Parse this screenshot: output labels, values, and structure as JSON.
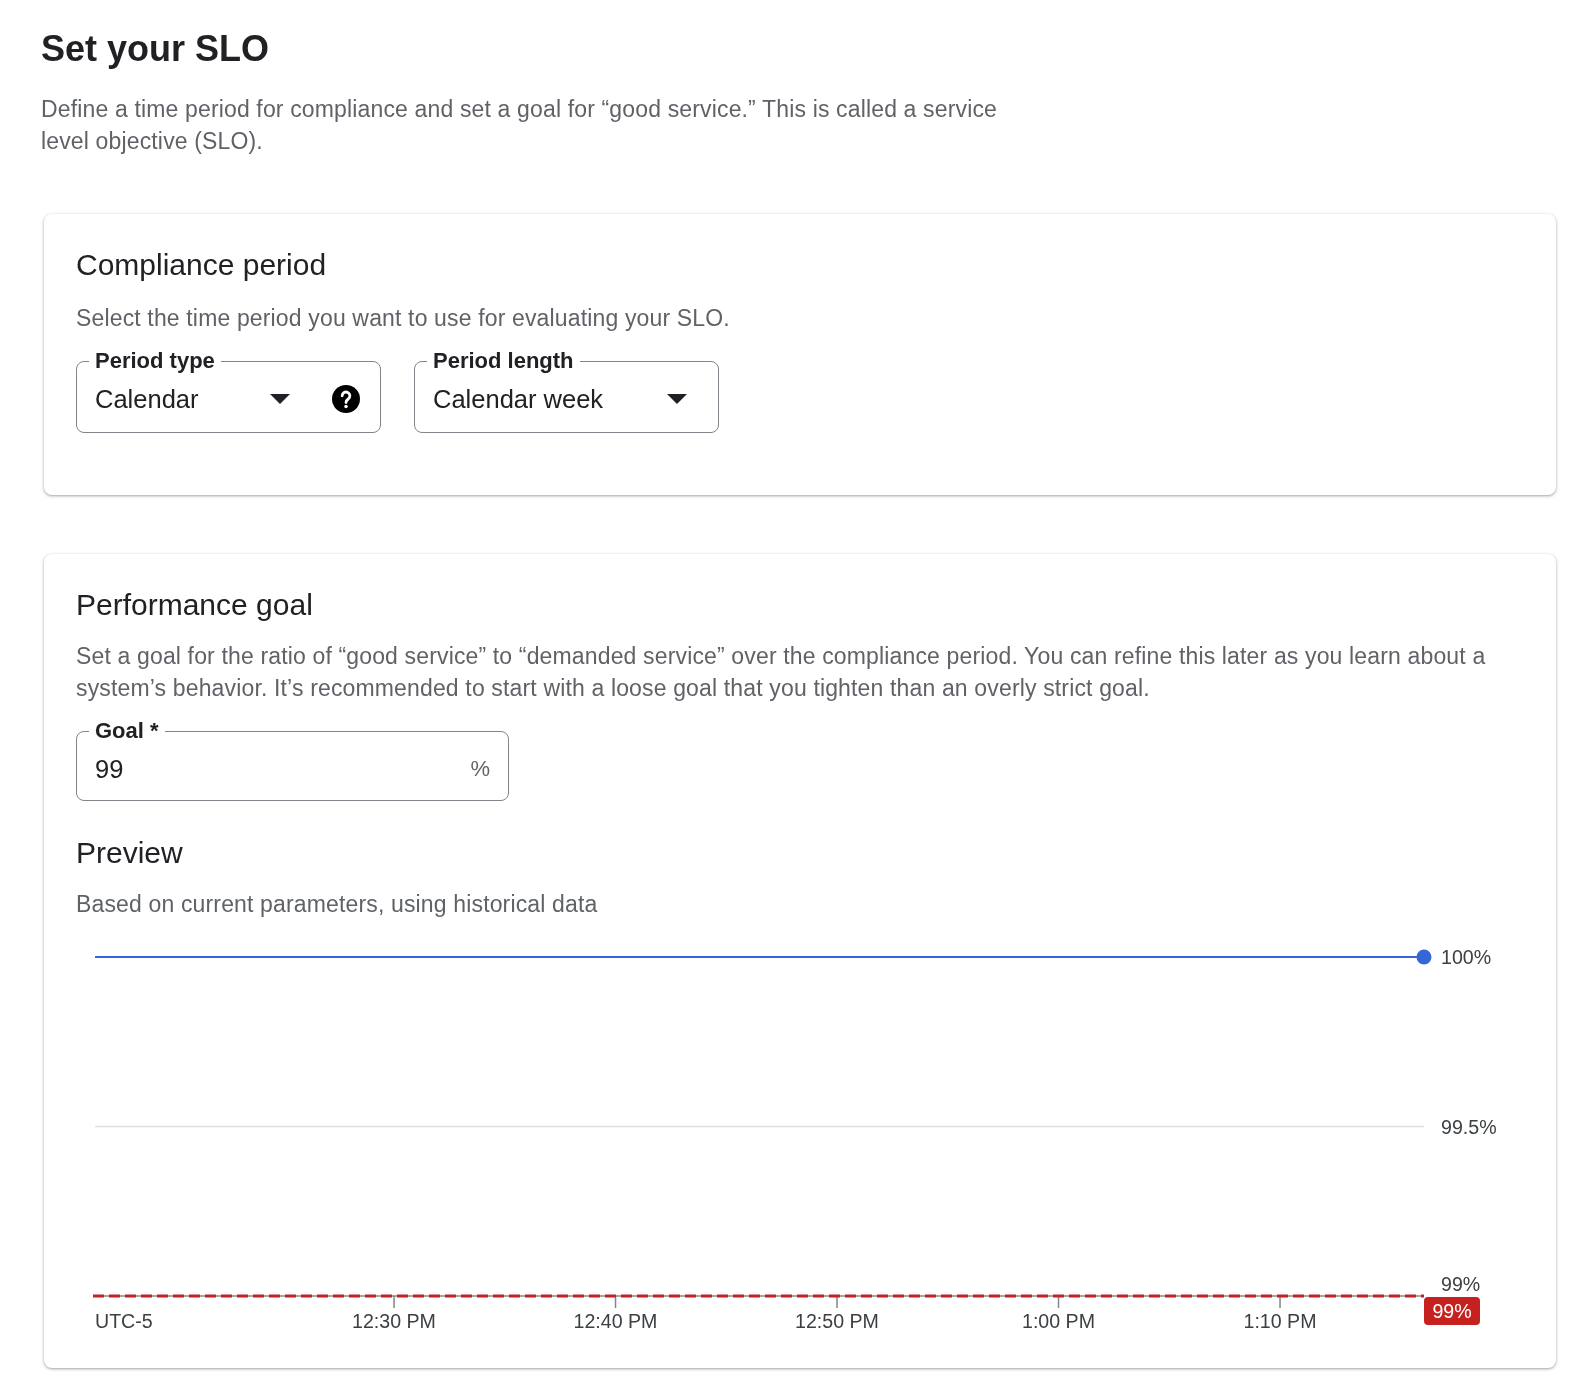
{
  "page": {
    "title": "Set your SLO",
    "description": "Define a time period for compliance and set a goal for “good service.” This is called a service level objective (SLO)."
  },
  "compliance_period": {
    "title": "Compliance period",
    "description": "Select the time period you want to use for evaluating your SLO.",
    "fields": [
      {
        "label": "Period type",
        "value": "Calendar",
        "help": true
      },
      {
        "label": "Period length",
        "value": "Calendar week",
        "help": false
      }
    ]
  },
  "performance_goal": {
    "title": "Performance goal",
    "description": "Set a goal for the ratio of “good service” to “demanded service” over the compliance period. You can refine this later as you learn about a system’s behavior. It’s recommended to start with a loose goal that you tighten than an overly strict goal.",
    "goal": {
      "label": "Goal *",
      "value": "99",
      "suffix": "%"
    },
    "preview": {
      "title": "Preview",
      "description": "Based on current parameters, using historical data",
      "chart_data": {
        "type": "line",
        "xlabel": "UTC-5",
        "categories": [
          null,
          null,
          null,
          null,
          null,
          null,
          null,
          null,
          null,
          null,
          null,
          null,
          null,
          null,
          null,
          null,
          null,
          null,
          null,
          null,
          null,
          null,
          null,
          null,
          null,
          null,
          null,
          "12:30 PM",
          null,
          null,
          null,
          null,
          null,
          null,
          null,
          null,
          null,
          null,
          null,
          null,
          null,
          null,
          null,
          null,
          null,
          null,
          null,
          "12:40 PM",
          null,
          null,
          null,
          null,
          null,
          null,
          null,
          null,
          null,
          null,
          null,
          null,
          null,
          null,
          null,
          null,
          null,
          null,
          null,
          "12:50 PM",
          null,
          null,
          null,
          null,
          null,
          null,
          null,
          null,
          null,
          null,
          null,
          null,
          null,
          null,
          null,
          null,
          null,
          null,
          null,
          "1:00 PM",
          null,
          null,
          null,
          null,
          null,
          null,
          null,
          null,
          null,
          null,
          null,
          null,
          null,
          null,
          null,
          null,
          null,
          null,
          null,
          "1:10 PM",
          null,
          null,
          null,
          null,
          null,
          null,
          null,
          null,
          null,
          null,
          null,
          null,
          null
        ],
        "series": [
          {
            "color": "#3367d6",
            "values": [
              100,
              100,
              100,
              100,
              100,
              100,
              100,
              100,
              100,
              100,
              100,
              100,
              100,
              100,
              100,
              100,
              100,
              100,
              100,
              100,
              100,
              100,
              100,
              100,
              100,
              100,
              100,
              100,
              100,
              100,
              100,
              100,
              100,
              100,
              100,
              100,
              100,
              100,
              100,
              100,
              100,
              100,
              100,
              100,
              100,
              100,
              100,
              100,
              100,
              100,
              100,
              100,
              100,
              100,
              100,
              100,
              100,
              100,
              100,
              100,
              100,
              100,
              100,
              100,
              100,
              100,
              100,
              100,
              100,
              100,
              100,
              100,
              100,
              100,
              100,
              100,
              100,
              100,
              100,
              100,
              100,
              100,
              100,
              100,
              100,
              100,
              100,
              100,
              100,
              100,
              100,
              100,
              100,
              100,
              100,
              100,
              100,
              100,
              100,
              100,
              100,
              100,
              100,
              100,
              100,
              100,
              100,
              100,
              100,
              100,
              100,
              100,
              100,
              100,
              100,
              100,
              100,
              100,
              100,
              100,
              100
            ]
          }
        ],
        "ylim": [
          99,
          100
        ],
        "yticks": [
          {
            "value": 99,
            "label": "99%"
          },
          {
            "value": 99.5,
            "label": "99.5%"
          },
          {
            "value": 100,
            "label": "100%"
          }
        ],
        "ref_lines": [
          {
            "axis": "y",
            "value": 99,
            "label": "99%",
            "color": "#c5221f"
          }
        ]
      }
    }
  }
}
